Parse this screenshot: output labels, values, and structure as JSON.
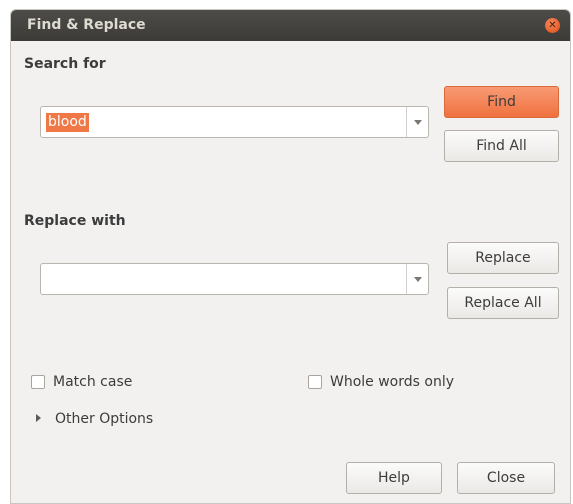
{
  "window": {
    "title": "Find & Replace"
  },
  "search": {
    "label": "Search for",
    "value": "blood",
    "find_button": "Find",
    "find_all_button": "Find All"
  },
  "replace": {
    "label": "Replace with",
    "value": "",
    "replace_button": "Replace",
    "replace_all_button": "Replace All"
  },
  "options": {
    "match_case": {
      "label": "Match case",
      "checked": false
    },
    "whole_words": {
      "label": "Whole words only",
      "checked": false
    },
    "other_options": "Other Options"
  },
  "footer": {
    "help_button": "Help",
    "close_button": "Close"
  },
  "colors": {
    "accent": "#f07746",
    "titlebar": "#3c3b37",
    "dialog_bg": "#f2f1f0"
  }
}
